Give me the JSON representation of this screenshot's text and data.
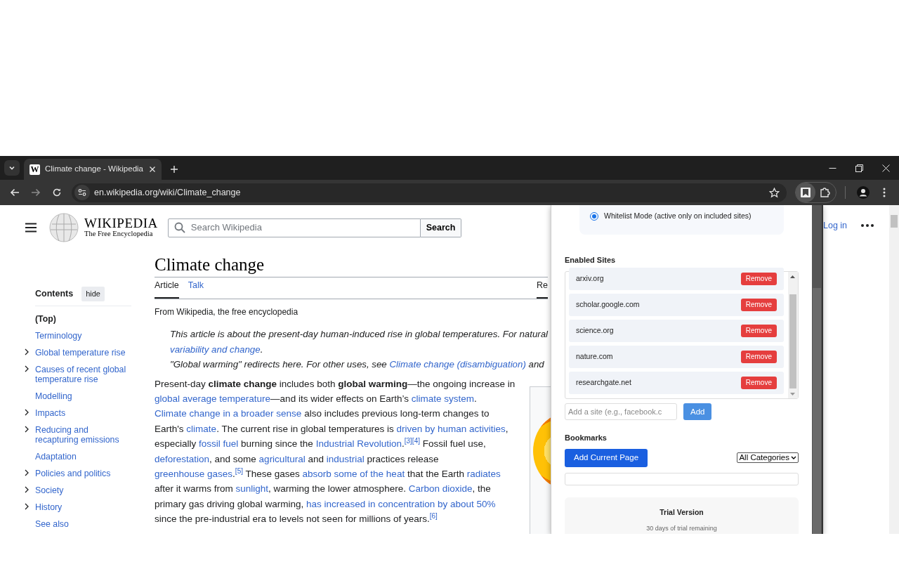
{
  "browser": {
    "tab": {
      "favicon": "W",
      "title": "Climate change - Wikipedia",
      "selected": true
    },
    "address": "en.wikipedia.org/wiki/Climate_change"
  },
  "wiki_header": {
    "logo_title": "WIKIPEDIA",
    "logo_subtitle": "The Free Encyclopedia",
    "search_placeholder": "Search Wikipedia",
    "search_button": "Search",
    "login": "Log in"
  },
  "toc": {
    "title": "Contents",
    "hide": "hide",
    "items": [
      {
        "label": "(Top)",
        "expandable": false,
        "selected": true
      },
      {
        "label": "Terminology",
        "expandable": false,
        "selected": false
      },
      {
        "label": "Global temperature rise",
        "expandable": true,
        "selected": false
      },
      {
        "label": "Causes of recent global temperature rise",
        "expandable": true,
        "selected": false
      },
      {
        "label": "Modelling",
        "expandable": false,
        "selected": false
      },
      {
        "label": "Impacts",
        "expandable": true,
        "selected": false
      },
      {
        "label": "Reducing and recapturing emissions",
        "expandable": true,
        "selected": false
      },
      {
        "label": "Adaptation",
        "expandable": false,
        "selected": false
      },
      {
        "label": "Policies and politics",
        "expandable": true,
        "selected": false
      },
      {
        "label": "Society",
        "expandable": true,
        "selected": false
      },
      {
        "label": "History",
        "expandable": true,
        "selected": false
      },
      {
        "label": "See also",
        "expandable": false,
        "selected": false
      }
    ]
  },
  "article": {
    "title": "Climate change",
    "tabs": [
      {
        "label": "Article",
        "selected": true
      },
      {
        "label": "Talk",
        "selected": false
      }
    ],
    "view_tabs": [
      {
        "label": "Re",
        "selected": true
      }
    ],
    "tagline": "From Wikipedia, the free encyclopedia",
    "hatnote_lines": [
      [
        {
          "kind": "text",
          "text": "This article is about the present-day human-induced rise in global temperatures. For natural"
        }
      ],
      [
        {
          "kind": "link",
          "text": "variability and change"
        },
        {
          "kind": "text",
          "text": "."
        }
      ],
      [
        {
          "kind": "text",
          "text": "\"Global warming\" redirects here. For other uses, see "
        },
        {
          "kind": "link",
          "text": "Climate change (disambiguation)"
        },
        {
          "kind": "text",
          "text": " and"
        }
      ]
    ],
    "paragraph": [
      {
        "kind": "text",
        "text": "Present-day "
      },
      {
        "kind": "bold",
        "text": "climate change"
      },
      {
        "kind": "text",
        "text": " includes both "
      },
      {
        "kind": "bold",
        "text": "global warming"
      },
      {
        "kind": "text",
        "text": "—the ongoing increase in "
      },
      {
        "kind": "link",
        "text": "global average temperature"
      },
      {
        "kind": "text",
        "text": "—and its wider effects on Earth’s "
      },
      {
        "kind": "link",
        "text": "climate system"
      },
      {
        "kind": "text",
        "text": ". "
      },
      {
        "kind": "link",
        "text": "Climate change in a broader sense"
      },
      {
        "kind": "text",
        "text": " also includes previous long-term changes to Earth's "
      },
      {
        "kind": "link",
        "text": "climate"
      },
      {
        "kind": "text",
        "text": ". The current rise in global temperatures is "
      },
      {
        "kind": "link",
        "text": "driven by human activities"
      },
      {
        "kind": "text",
        "text": ", especially "
      },
      {
        "kind": "link",
        "text": "fossil fuel"
      },
      {
        "kind": "text",
        "text": " burning since the "
      },
      {
        "kind": "link",
        "text": "Industrial Revolution"
      },
      {
        "kind": "text",
        "text": "."
      },
      {
        "kind": "ref",
        "text": "[3]"
      },
      {
        "kind": "ref",
        "text": "[4]"
      },
      {
        "kind": "text",
        "text": " Fossil fuel use, "
      },
      {
        "kind": "link",
        "text": "deforestation"
      },
      {
        "kind": "text",
        "text": ", and some "
      },
      {
        "kind": "link",
        "text": "agricultural"
      },
      {
        "kind": "text",
        "text": " and "
      },
      {
        "kind": "link",
        "text": "industrial"
      },
      {
        "kind": "text",
        "text": " practices release "
      },
      {
        "kind": "link",
        "text": "greenhouse gases"
      },
      {
        "kind": "text",
        "text": "."
      },
      {
        "kind": "ref",
        "text": "[5]"
      },
      {
        "kind": "text",
        "text": " These gases "
      },
      {
        "kind": "link",
        "text": "absorb some of the heat"
      },
      {
        "kind": "text",
        "text": " that the Earth "
      },
      {
        "kind": "link",
        "text": "radiates"
      },
      {
        "kind": "text",
        "text": " after it warms from "
      },
      {
        "kind": "link",
        "text": "sunlight"
      },
      {
        "kind": "text",
        "text": ", warming the lower atmosphere. "
      },
      {
        "kind": "link",
        "text": "Carbon dioxide"
      },
      {
        "kind": "text",
        "text": ", the primary gas driving global warming, "
      },
      {
        "kind": "link",
        "text": "has increased in concentration by about 50%"
      },
      {
        "kind": "text",
        "text": " since the pre-industrial era to levels not seen for millions of years."
      },
      {
        "kind": "ref",
        "text": "[6]"
      }
    ]
  },
  "popup": {
    "mode_option": {
      "label": "Whitelist Mode (active only on included sites)",
      "selected": true
    },
    "sites_heading": "Enabled Sites",
    "sites": [
      {
        "domain": "arxiv.org",
        "action": "Remove"
      },
      {
        "domain": "scholar.google.com",
        "action": "Remove"
      },
      {
        "domain": "science.org",
        "action": "Remove"
      },
      {
        "domain": "nature.com",
        "action": "Remove"
      },
      {
        "domain": "researchgate.net",
        "action": "Remove"
      }
    ],
    "add_placeholder": "Add a site (e.g., facebook.c",
    "add_button": "Add",
    "bookmarks_heading": "Bookmarks",
    "add_page_button": "Add Current Page",
    "category_select": "All Categories",
    "trial": {
      "title": "Trial Version",
      "remaining": "30 days of trial remaining"
    }
  }
}
